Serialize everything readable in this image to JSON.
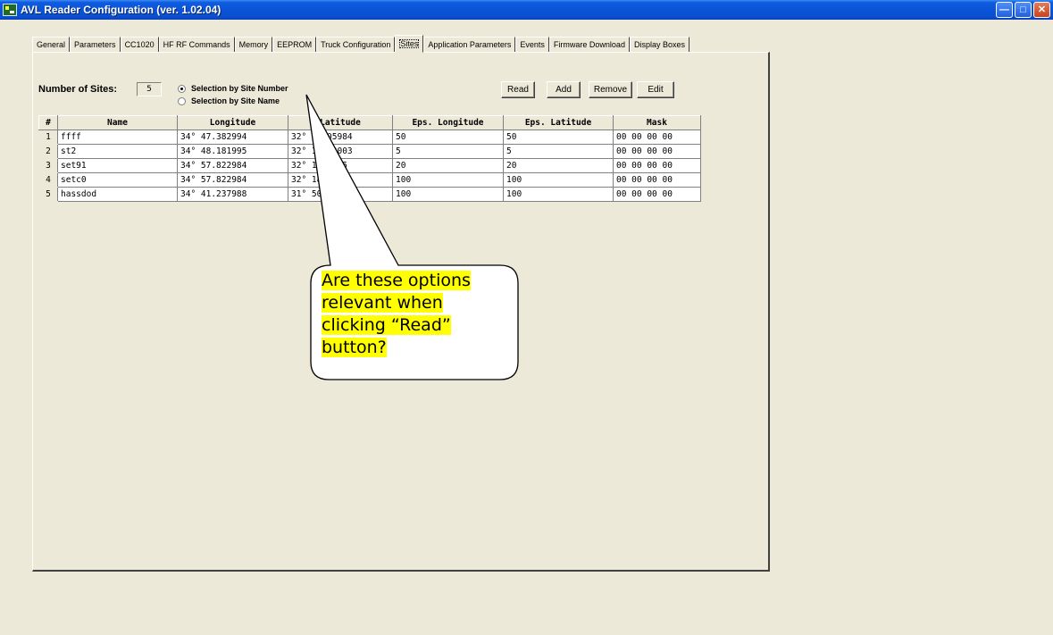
{
  "window": {
    "title": "AVL Reader Configuration (ver. 1.02.04)",
    "controls": [
      "minimize",
      "maximize",
      "close"
    ]
  },
  "tabs": [
    {
      "label": "General"
    },
    {
      "label": "Parameters"
    },
    {
      "label": "CC1020"
    },
    {
      "label": "HF RF Commands"
    },
    {
      "label": "Memory"
    },
    {
      "label": "EEPROM"
    },
    {
      "label": "Truck Configuration"
    },
    {
      "label": "Sites",
      "active": true
    },
    {
      "label": "Application Parameters"
    },
    {
      "label": "Events"
    },
    {
      "label": "Firmware Download"
    },
    {
      "label": "Display Boxes"
    }
  ],
  "sites": {
    "count_label": "Number of Sites:",
    "count_value": "5",
    "radio_site_number": "Selection by Site Number",
    "radio_site_name": "Selection by Site Name",
    "selected_radio": "site_number",
    "buttons": {
      "read": "Read",
      "add": "Add",
      "remove": "Remove",
      "edit": "Edit"
    }
  },
  "table": {
    "headers": [
      "#",
      "Name",
      "Longitude",
      "Latitude",
      "Eps. Longitude",
      "Eps. Latitude",
      "Mask"
    ],
    "rows": [
      [
        "1",
        "ffff",
        "34° 47.382994",
        "32° 1.205984",
        "50",
        "50",
        "00 00 00 00"
      ],
      [
        "2",
        "st2",
        "34° 48.181995",
        "32° 1.952003",
        "5",
        "5",
        "00 00 00 00"
      ],
      [
        "3",
        "set91",
        "34° 57.822984",
        "32° 1.35985",
        "20",
        "20",
        "00 00 00 00"
      ],
      [
        "4",
        "setc0",
        "34° 57.822984",
        "32° 18.999",
        "100",
        "100",
        "00 00 00 00"
      ],
      [
        "5",
        "hassdod",
        "34° 41.237988",
        "31° 50.98",
        "100",
        "100",
        "00 00 00 00"
      ]
    ]
  },
  "callout": {
    "lines": [
      "Are these options",
      "relevant when",
      "clicking “Read”",
      "button?"
    ],
    "highlight_color": "#ffff00"
  }
}
